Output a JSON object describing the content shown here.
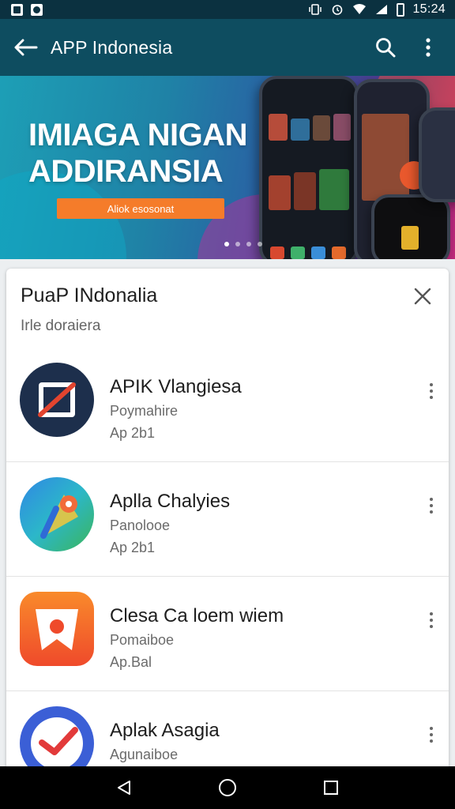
{
  "status_bar": {
    "time": "15:24"
  },
  "app_bar": {
    "title": "APP Indonesia"
  },
  "banner": {
    "headline_line1": "IMIAGA NIGAN",
    "headline_line2": "ADDIRANSIA",
    "cta_label": "Aliok esosonat",
    "slide_count": 4,
    "active_slide": 1
  },
  "card": {
    "title": "PuaP INdonalia",
    "subtitle": "Irle doraiera",
    "apps": [
      {
        "name": "APIK Vlangiesa",
        "category": "Poymahire",
        "meta": "Ap 2b1",
        "icon": "blocked-square-icon",
        "color": "#1d2f4c"
      },
      {
        "name": "Aplla Chalyies",
        "category": "Panolooe",
        "meta": "Ap 2b1",
        "icon": "maps-pin-icon",
        "color": "#2ba8d9"
      },
      {
        "name": "Clesa Ca loem wiem",
        "category": "Pomaiboe",
        "meta": "Ap.Bal",
        "icon": "star-badge-icon",
        "color": "#f4682a"
      },
      {
        "name": "Aplak Asagia",
        "category": "Agunaiboe",
        "meta": "",
        "icon": "check-compass-icon",
        "color": "#3b5fd6"
      }
    ]
  },
  "colors": {
    "app_bar": "#0e4d60",
    "status_bar": "#0b3140",
    "cta": "#f57c2a"
  }
}
